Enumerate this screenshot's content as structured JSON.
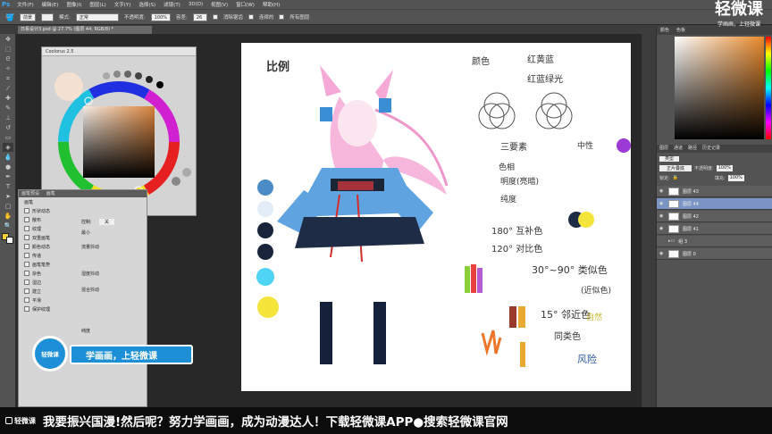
{
  "menubar": {
    "app_logo": "Ps",
    "items": [
      "文件(F)",
      "编辑(E)",
      "图像(I)",
      "图层(L)",
      "文字(Y)",
      "选择(S)",
      "滤镜(T)",
      "3D(D)",
      "视图(V)",
      "窗口(W)",
      "帮助(H)"
    ]
  },
  "options": {
    "brush_preset": "前景",
    "mode_label": "模式:",
    "mode_value": "正常",
    "opacity_label": "不透明度:",
    "opacity_value": "100%",
    "tolerance_label": "容差:",
    "tolerance_value": "26",
    "antialias_label": "消除锯齿",
    "contiguous_label": "连续的",
    "all_layers_label": "所有图层"
  },
  "document_tab": "日系设计3.psd @ 27.7% (图层 44, RGB/8) *",
  "coolorus": {
    "title": "Coolorus 2.5"
  },
  "brush_panel": {
    "tabs": [
      "画笔预设",
      "画笔"
    ],
    "header": "画笔",
    "items": [
      "形状动态",
      "散布",
      "纹理",
      "双重画笔",
      "颜色动态",
      "传递",
      "画笔笔势",
      "杂色",
      "湿边",
      "建立",
      "平滑",
      "保护纹理"
    ],
    "control_label": "控制:",
    "control_value": "关",
    "min_label": "最小",
    "jitter_label": "流量抖动",
    "jitter2_label": "湿度抖动",
    "jitter3_label": "混合抖动",
    "purity_label": "纯度"
  },
  "swatches_tabs": [
    "颜色",
    "色板"
  ],
  "layers_panel": {
    "tabs": [
      "图层",
      "通道",
      "路径",
      "历史记录"
    ],
    "kind_label": "类型",
    "blend_mode": "正片叠底",
    "opacity_label": "不透明度:",
    "opacity_value": "100%",
    "lock_label": "锁定:",
    "fill_label": "填充:",
    "fill_value": "100%",
    "layers": [
      {
        "name": "图层 43",
        "selected": false
      },
      {
        "name": "图层 44",
        "selected": true
      },
      {
        "name": "图层 42",
        "selected": false
      },
      {
        "name": "图层 41",
        "selected": false
      },
      {
        "name": "组 3",
        "selected": false
      },
      {
        "name": "图层 0",
        "selected": false
      }
    ]
  },
  "watermark": {
    "title": "轻微课",
    "subtitle": "学画画，上轻微课"
  },
  "badge": {
    "brand": "轻微课",
    "slogan": "学画画，上轻微课"
  },
  "bottom_banner": {
    "brand": "轻微课",
    "message": "我要振兴国漫!然后呢？努力学画画，成为动漫达人！下载轻微课APP●搜索轻微课官网"
  },
  "canvas_notes": {
    "example": "比例",
    "color": "颜色",
    "primary": "红黄蓝",
    "secondary": "红蓝绿光",
    "three_elements": "三要素",
    "hue": "色相",
    "brightness": "明度(亮暗)",
    "saturation": "纯度",
    "complement": "180° 互补色",
    "contrast": "120° 对比色",
    "analog_range": "30°~90° 类似色",
    "analog_sub": "(近似色)",
    "adjacent": "15° 邻近色",
    "same": "同类色",
    "nature": "自然",
    "neutral": "中性",
    "bottom": "风险"
  },
  "colors": {
    "accent_blue": "#3fa9f5",
    "badge_blue": "#1c8fd6",
    "selected_layer": "#7a95c3"
  }
}
